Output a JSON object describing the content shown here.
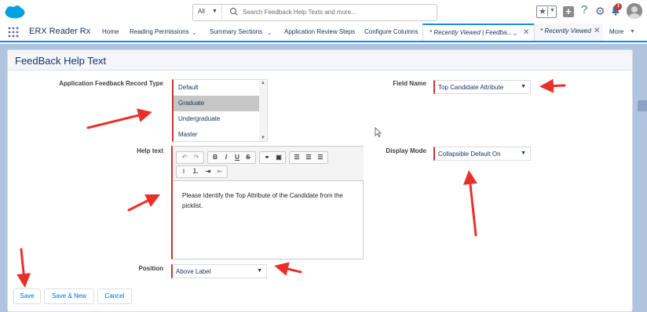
{
  "header": {
    "search_scope": "All",
    "search_placeholder": "Search Feedback Help Texts and more...",
    "notification_count": "1"
  },
  "nav": {
    "app_name": "ERX Reader Rx",
    "items": [
      "Home",
      "Reading Permissions",
      "Summary Sections",
      "Application Review Steps",
      "Configure Columns"
    ],
    "tabs": [
      "* Recently Viewed | Feedba...",
      "* Recently Viewed"
    ],
    "more": "More"
  },
  "card": {
    "title": "FeedBack Help Text"
  },
  "form": {
    "record_type_label": "Application Feedback Record Type",
    "record_type_options": [
      "Default",
      "Graduate",
      "Undergraduate",
      "Master"
    ],
    "record_type_selected": "Graduate",
    "help_text_label": "Help text",
    "help_text_value": "Please Identify the Top Attribute of the Candidate from the picklist.",
    "position_label": "Position",
    "position_value": "Above Label",
    "field_name_label": "Field Name",
    "field_name_value": "Top Candidate Attribute",
    "display_mode_label": "Display Mode",
    "display_mode_value": "Collapsible Default On"
  },
  "toolbar": {
    "bold": "B",
    "italic": "I",
    "underline": "U",
    "strike": "S"
  },
  "buttons": {
    "save": "Save",
    "save_new": "Save & New",
    "cancel": "Cancel"
  },
  "colors": {
    "brand": "#1589ee",
    "required_bar": "#c23934",
    "annotation_arrow": "#e8302a",
    "page_bg": "#b0c4df"
  }
}
